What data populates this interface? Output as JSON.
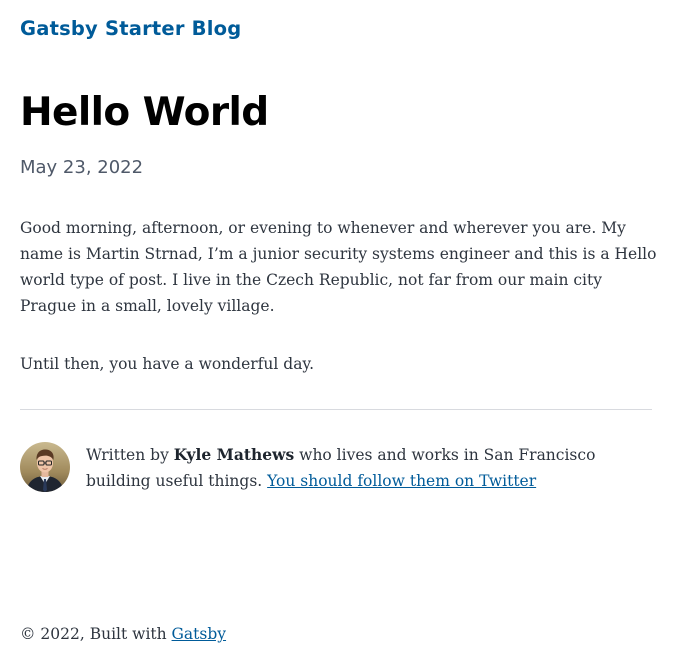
{
  "site": {
    "title": "Gatsby Starter Blog"
  },
  "post": {
    "title": "Hello World",
    "date": "May 23, 2022",
    "paragraphs": [
      "Good morning, afternoon, or evening to whenever and wherever you are. My name is Martin Strnad, I’m a junior security systems engineer and this is a Hello world type of post. I live in the Czech Republic, not far from our main city Prague in a small, lovely village.",
      "Until then, you have a wonderful day."
    ]
  },
  "bio": {
    "prefix": "Written by ",
    "author": "Kyle Mathews",
    "middle": " who lives and works in San Francisco building useful things. ",
    "link_text": "You should follow them on Twitter"
  },
  "footer": {
    "prefix": "© 2022, Built with ",
    "link_text": "Gatsby"
  },
  "colors": {
    "link": "#005b99",
    "text": "#2e353f",
    "divider": "#d8dadf"
  },
  "icons": {
    "avatar": "profile-picture"
  }
}
